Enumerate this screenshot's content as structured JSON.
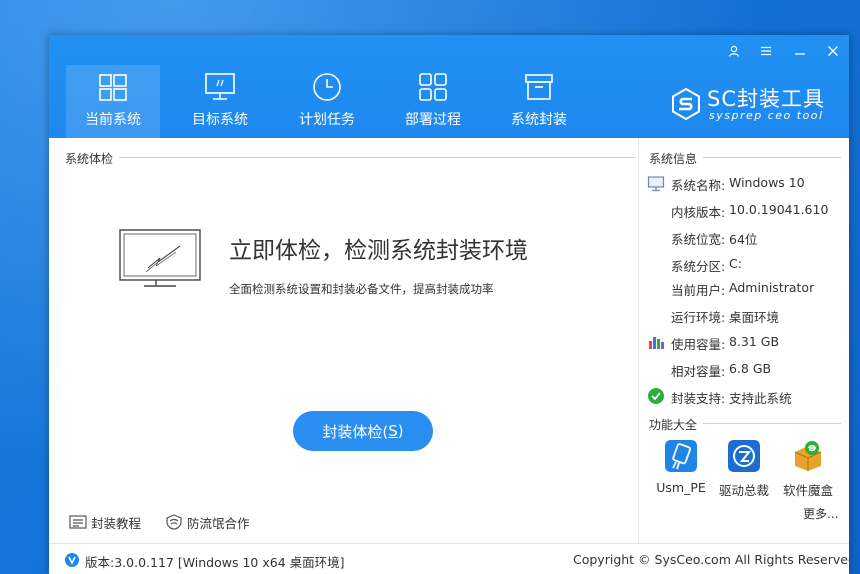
{
  "window": {
    "controls": {
      "user": "user-icon",
      "menu": "menu-icon",
      "minimize": "minimize-icon",
      "close": "close-icon"
    }
  },
  "tabs": [
    {
      "label": "当前系统",
      "icon": "windows-icon",
      "active": true
    },
    {
      "label": "目标系统",
      "icon": "monitor-icon",
      "active": false
    },
    {
      "label": "计划任务",
      "icon": "clock-icon",
      "active": false
    },
    {
      "label": "部署过程",
      "icon": "grid-icon",
      "active": false
    },
    {
      "label": "系统封装",
      "icon": "package-icon",
      "active": false
    }
  ],
  "logo": {
    "main": "SC封装工具",
    "sub": "sysprep ceo tool"
  },
  "check": {
    "section_title": "系统体检",
    "headline": "立即体检，检测系统封装环境",
    "subtext": "全面检测系统设置和封装必备文件，提高封装成功率",
    "button_label": "封装体检(",
    "button_hotkey": "S",
    "button_close": ")"
  },
  "info": {
    "section_title": "系统信息",
    "rows": [
      {
        "key": "系统名称:",
        "value": "Windows 10"
      },
      {
        "key": "内核版本:",
        "value": "10.0.19041.610"
      },
      {
        "key": "系统位宽:",
        "value": "64位"
      },
      {
        "key": "系统分区:",
        "value": "C:"
      },
      {
        "key": "当前用户:",
        "value": "Administrator"
      },
      {
        "key": "运行环境:",
        "value": "桌面环境"
      },
      {
        "key": "使用容量:",
        "value": "8.31 GB"
      },
      {
        "key": "相对容量:",
        "value": "6.8 GB"
      },
      {
        "key": "封装支持:",
        "value": "支持此系统"
      }
    ]
  },
  "functions": {
    "section_title": "功能大全",
    "items": [
      {
        "label": "Usm_PE",
        "icon": "usb-icon"
      },
      {
        "label": "驱动总裁",
        "icon": "driver-icon"
      },
      {
        "label": "软件魔盒",
        "icon": "box-icon"
      }
    ],
    "more": "更多..."
  },
  "bottom_links": [
    {
      "label": "封装教程",
      "icon": "tutorial-icon"
    },
    {
      "label": "防流氓合作",
      "icon": "shield-icon"
    }
  ],
  "footer": {
    "version": "版本:3.0.0.117 [Windows 10 x64 桌面环境]",
    "copyright": "Copyright © SysCeo.com All Rights Reserved."
  },
  "colors": {
    "accent": "#1e88ef",
    "button": "#2a8ef0",
    "success": "#2dae36"
  }
}
